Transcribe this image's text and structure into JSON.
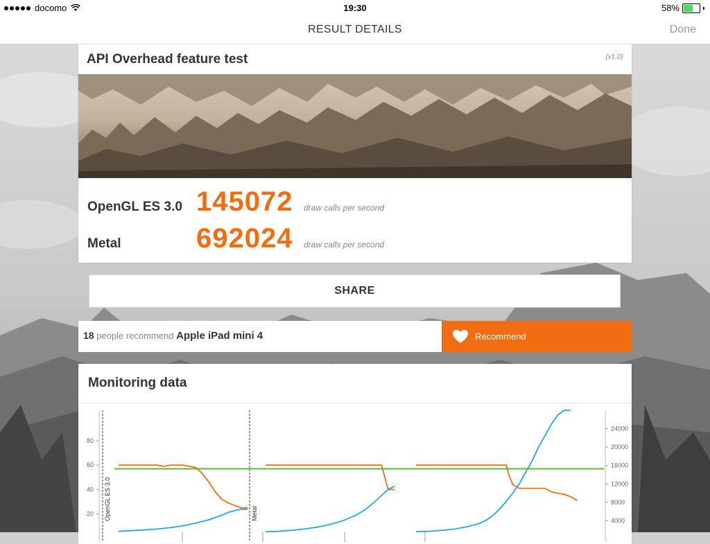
{
  "status_bar": {
    "carrier": "docomo",
    "time": "19:30",
    "battery_percent": "58%",
    "battery_level": 0.58,
    "battery_color": "#4cd964"
  },
  "nav": {
    "title": "RESULT DETAILS",
    "done_label": "Done"
  },
  "result": {
    "title": "API Overhead feature test",
    "version": "(v1.0)",
    "scores": [
      {
        "label": "OpenGL ES 3.0",
        "value": "145072",
        "unit": "draw calls per second"
      },
      {
        "label": "Metal",
        "value": "692024",
        "unit": "draw calls per second"
      }
    ],
    "accent_color": "#f26d12"
  },
  "share": {
    "label": "SHARE"
  },
  "recommend": {
    "count": "18",
    "text": "people recommend",
    "device": "Apple iPad mini 4",
    "button_label": "Recommend",
    "icon": "heart-icon"
  },
  "monitoring": {
    "title": "Monitoring data"
  },
  "chart_data": {
    "type": "line",
    "left_axis": {
      "ticks": [
        20,
        40,
        60,
        80
      ],
      "range": [
        5,
        105
      ]
    },
    "right_axis": {
      "ticks": [
        4000,
        8000,
        12000,
        16000,
        20000,
        24000
      ],
      "range": [
        1500,
        28000
      ]
    },
    "segment_labels": [
      "OpenGL ES 3.0",
      "Metal"
    ],
    "series": [
      {
        "color": "#f26d12",
        "axis": "left",
        "segments": [
          [
            [
              0,
              60
            ],
            [
              0.1,
              60
            ],
            [
              0.2,
              60
            ],
            [
              0.3,
              60
            ],
            [
              0.35,
              59
            ],
            [
              0.4,
              60
            ],
            [
              0.5,
              60
            ],
            [
              0.55,
              59
            ],
            [
              0.6,
              58
            ],
            [
              0.65,
              53
            ],
            [
              0.7,
              46
            ],
            [
              0.75,
              38
            ],
            [
              0.8,
              32
            ],
            [
              0.85,
              29
            ],
            [
              0.9,
              27
            ],
            [
              0.95,
              25
            ],
            [
              1.0,
              25
            ]
          ],
          [
            [
              0,
              60
            ],
            [
              0.2,
              60
            ],
            [
              0.5,
              60
            ],
            [
              0.8,
              60
            ],
            [
              0.9,
              60
            ],
            [
              0.92,
              52
            ],
            [
              0.95,
              40
            ],
            [
              1.0,
              40
            ]
          ],
          [
            [
              0,
              60
            ],
            [
              0.2,
              60
            ],
            [
              0.4,
              60
            ],
            [
              0.6,
              60
            ],
            [
              0.7,
              60
            ],
            [
              0.72,
              52
            ],
            [
              0.75,
              44
            ],
            [
              0.8,
              41
            ],
            [
              0.85,
              41
            ],
            [
              0.9,
              41
            ],
            [
              1.0,
              41
            ],
            [
              1.05,
              38
            ],
            [
              1.1,
              37
            ],
            [
              1.15,
              36
            ],
            [
              1.2,
              34
            ],
            [
              1.25,
              31
            ]
          ]
        ]
      },
      {
        "color": "#22a7e8",
        "axis": "right",
        "segments": [
          [
            [
              0,
              1700
            ],
            [
              0.1,
              1850
            ],
            [
              0.2,
              2000
            ],
            [
              0.3,
              2200
            ],
            [
              0.4,
              2500
            ],
            [
              0.5,
              2900
            ],
            [
              0.6,
              3500
            ],
            [
              0.7,
              4200
            ],
            [
              0.8,
              5200
            ],
            [
              0.85,
              5800
            ],
            [
              0.9,
              6200
            ],
            [
              0.95,
              6500
            ],
            [
              1.0,
              6500
            ]
          ],
          [
            [
              0,
              1600
            ],
            [
              0.1,
              1700
            ],
            [
              0.2,
              1900
            ],
            [
              0.3,
              2200
            ],
            [
              0.4,
              2600
            ],
            [
              0.5,
              3200
            ],
            [
              0.6,
              4000
            ],
            [
              0.7,
              5200
            ],
            [
              0.75,
              6000
            ],
            [
              0.8,
              7000
            ],
            [
              0.85,
              8200
            ],
            [
              0.9,
              9500
            ],
            [
              0.95,
              10800
            ],
            [
              1.0,
              11500
            ]
          ],
          [
            [
              0,
              1600
            ],
            [
              0.1,
              1700
            ],
            [
              0.2,
              1900
            ],
            [
              0.3,
              2200
            ],
            [
              0.4,
              2700
            ],
            [
              0.5,
              3500
            ],
            [
              0.55,
              4200
            ],
            [
              0.6,
              5200
            ],
            [
              0.65,
              6600
            ],
            [
              0.7,
              8200
            ],
            [
              0.75,
              10000
            ],
            [
              0.8,
              12000
            ],
            [
              0.85,
              14500
            ],
            [
              0.9,
              17000
            ],
            [
              0.95,
              20000
            ],
            [
              1.0,
              22500
            ],
            [
              1.05,
              25000
            ],
            [
              1.1,
              27000
            ],
            [
              1.15,
              28000
            ],
            [
              1.2,
              28000
            ]
          ]
        ]
      },
      {
        "color": "#5cb82e",
        "axis": "left",
        "segments": [
          [
            [
              0,
              57
            ],
            [
              1,
              57
            ]
          ]
        ]
      }
    ],
    "grid": false,
    "legend": "none"
  }
}
